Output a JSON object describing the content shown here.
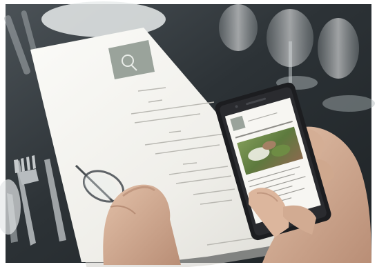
{
  "photo": {
    "subject": "",
    "colors": {
      "frame": "#ffffff",
      "table": "#2f3438",
      "table_dark": "#1f2427",
      "paper": "#f1f0ec",
      "paper_shadow": "#d9d8d3",
      "logo_square": "#9aa39b",
      "phone_body": "#1c1d20",
      "phone_screen": "#f7f6f2",
      "food_green": "#6d8a4b",
      "food_brown": "#8a6a4e",
      "skin": "#d8b49c",
      "skin_shadow": "#c19880",
      "glass": "#bfc6c8",
      "cutlery": "#9ea3a6"
    }
  }
}
